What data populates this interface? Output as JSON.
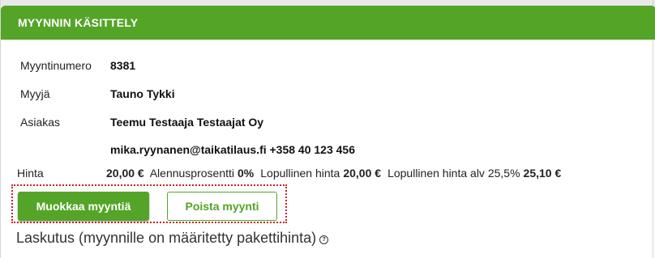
{
  "header": {
    "title": "MYYNNIN KÄSITTELY"
  },
  "details": {
    "sale_number_label": "Myyntinumero",
    "sale_number": "8381",
    "seller_label": "Myyjä",
    "seller": "Tauno Tykki",
    "customer_label": "Asiakas",
    "customer": "Teemu Testaaja Testaajat Oy",
    "customer_contact": "mika.ryynanen@taikatilaus.fi +358 40 123 456"
  },
  "pricing": {
    "price_label": "Hinta",
    "price": "20,00 €",
    "discount_label": "Alennusprosentti",
    "discount": "0%",
    "final_label": "Lopullinen hinta",
    "final": "20,00 €",
    "final_vat_label": "Lopullinen hinta alv 25,5%",
    "final_vat": "25,10 €"
  },
  "actions": {
    "edit_label": "Muokkaa myyntiä",
    "delete_label": "Poista myynti"
  },
  "billing": {
    "title": "Laskutus (myynnille on määritetty pakettihinta)",
    "help_icon": "question-circle-icon"
  },
  "colors": {
    "accent": "#54a428",
    "highlight_border": "#d02020"
  }
}
